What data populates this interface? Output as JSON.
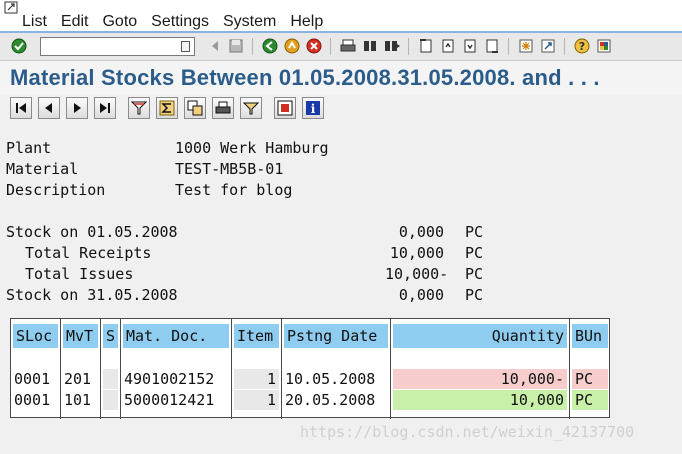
{
  "menu": {
    "items": [
      "List",
      "Edit",
      "Goto",
      "Settings",
      "System",
      "Help"
    ]
  },
  "toolbar": {
    "command_value": "",
    "icons": [
      "enter-icon",
      "command-dropdown-icon",
      "back-arrow-icon",
      "save-icon",
      "back-icon",
      "exit-icon",
      "cancel-icon",
      "print-icon",
      "find-icon",
      "find-next-icon",
      "first-page-icon",
      "previous-page-icon",
      "next-page-icon",
      "last-page-icon",
      "create-session-icon",
      "shortcut-icon",
      "help-icon",
      "customize-layout-icon"
    ]
  },
  "title": "Material Stocks Between 01.05.2008.31.05.2008. and . . .",
  "app_toolbar": {
    "icons": [
      "first-icon",
      "previous-icon",
      "next-icon",
      "last-icon",
      "filter-icon",
      "sum-icon",
      "subtotal-icon",
      "print-icon",
      "set-filter-icon",
      "export-icon",
      "info-icon"
    ]
  },
  "header": {
    "plant_label": "Plant",
    "plant_value": "1000 Werk Hamburg",
    "material_label": "Material",
    "material_value": "TEST-MB5B-01",
    "description_label": "Description",
    "description_value": "Test for blog"
  },
  "stock": {
    "opening_label": "Stock on 01.05.2008",
    "opening_value": "0,000",
    "opening_unit": "PC",
    "receipts_label": "Total Receipts",
    "receipts_value": "10,000",
    "receipts_unit": "PC",
    "issues_label": "Total Issues",
    "issues_value": "10,000-",
    "issues_unit": "PC",
    "closing_label": "Stock on 31.05.2008",
    "closing_value": "0,000",
    "closing_unit": "PC"
  },
  "table": {
    "headers": {
      "sloc": "SLoc",
      "mvt": "MvT",
      "s": "S",
      "matdoc": "Mat. Doc.",
      "item": "Item",
      "date": "Pstng Date",
      "qty": "Quantity",
      "bun": "BUn"
    },
    "rows": [
      {
        "sloc": "0001",
        "mvt": "201",
        "s": "",
        "matdoc": "4901002152",
        "item": "1",
        "date": "10.05.2008",
        "qty": "10,000-",
        "bun": "PC"
      },
      {
        "sloc": "0001",
        "mvt": "101",
        "s": "",
        "matdoc": "5000012421",
        "item": "1",
        "date": "20.05.2008",
        "qty": "10,000",
        "bun": "PC"
      }
    ]
  },
  "watermark": "https://blog.csdn.net/weixin_42137700",
  "colors": {
    "title": "#2c5c8a",
    "header_cell": "#8ecdf0",
    "negative_qty": "#f6cccc",
    "positive_qty": "#c8f0a8"
  }
}
